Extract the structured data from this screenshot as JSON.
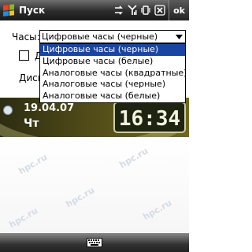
{
  "titlebar": {
    "title": "Пуск",
    "ok_label": "ok",
    "icons": [
      "windows-start-icon",
      "signal-arrows-icon",
      "antenna-icon",
      "vibrate-icon",
      "close-icon"
    ]
  },
  "form": {
    "clock_label": "Часы:",
    "clock_value": "Цифровые часы (черные)",
    "checkbox_label": "Д",
    "display_label": "Диспл"
  },
  "dropdown": {
    "options": [
      "Цифровые часы (черные)",
      "Цифровые часы (белые)",
      "Аналоговые часы (квадратные)",
      "Аналоговые часы (черные)",
      "Аналоговые часы (белые)"
    ],
    "selected_index": 0
  },
  "today": {
    "date": "19.04.07",
    "day": "Чт",
    "time": "16:34"
  },
  "watermark": "hpc.ru",
  "colors": {
    "selection": "#1b45a3",
    "titlebar": "#2b2b2b",
    "banner": "#4f4a18"
  }
}
